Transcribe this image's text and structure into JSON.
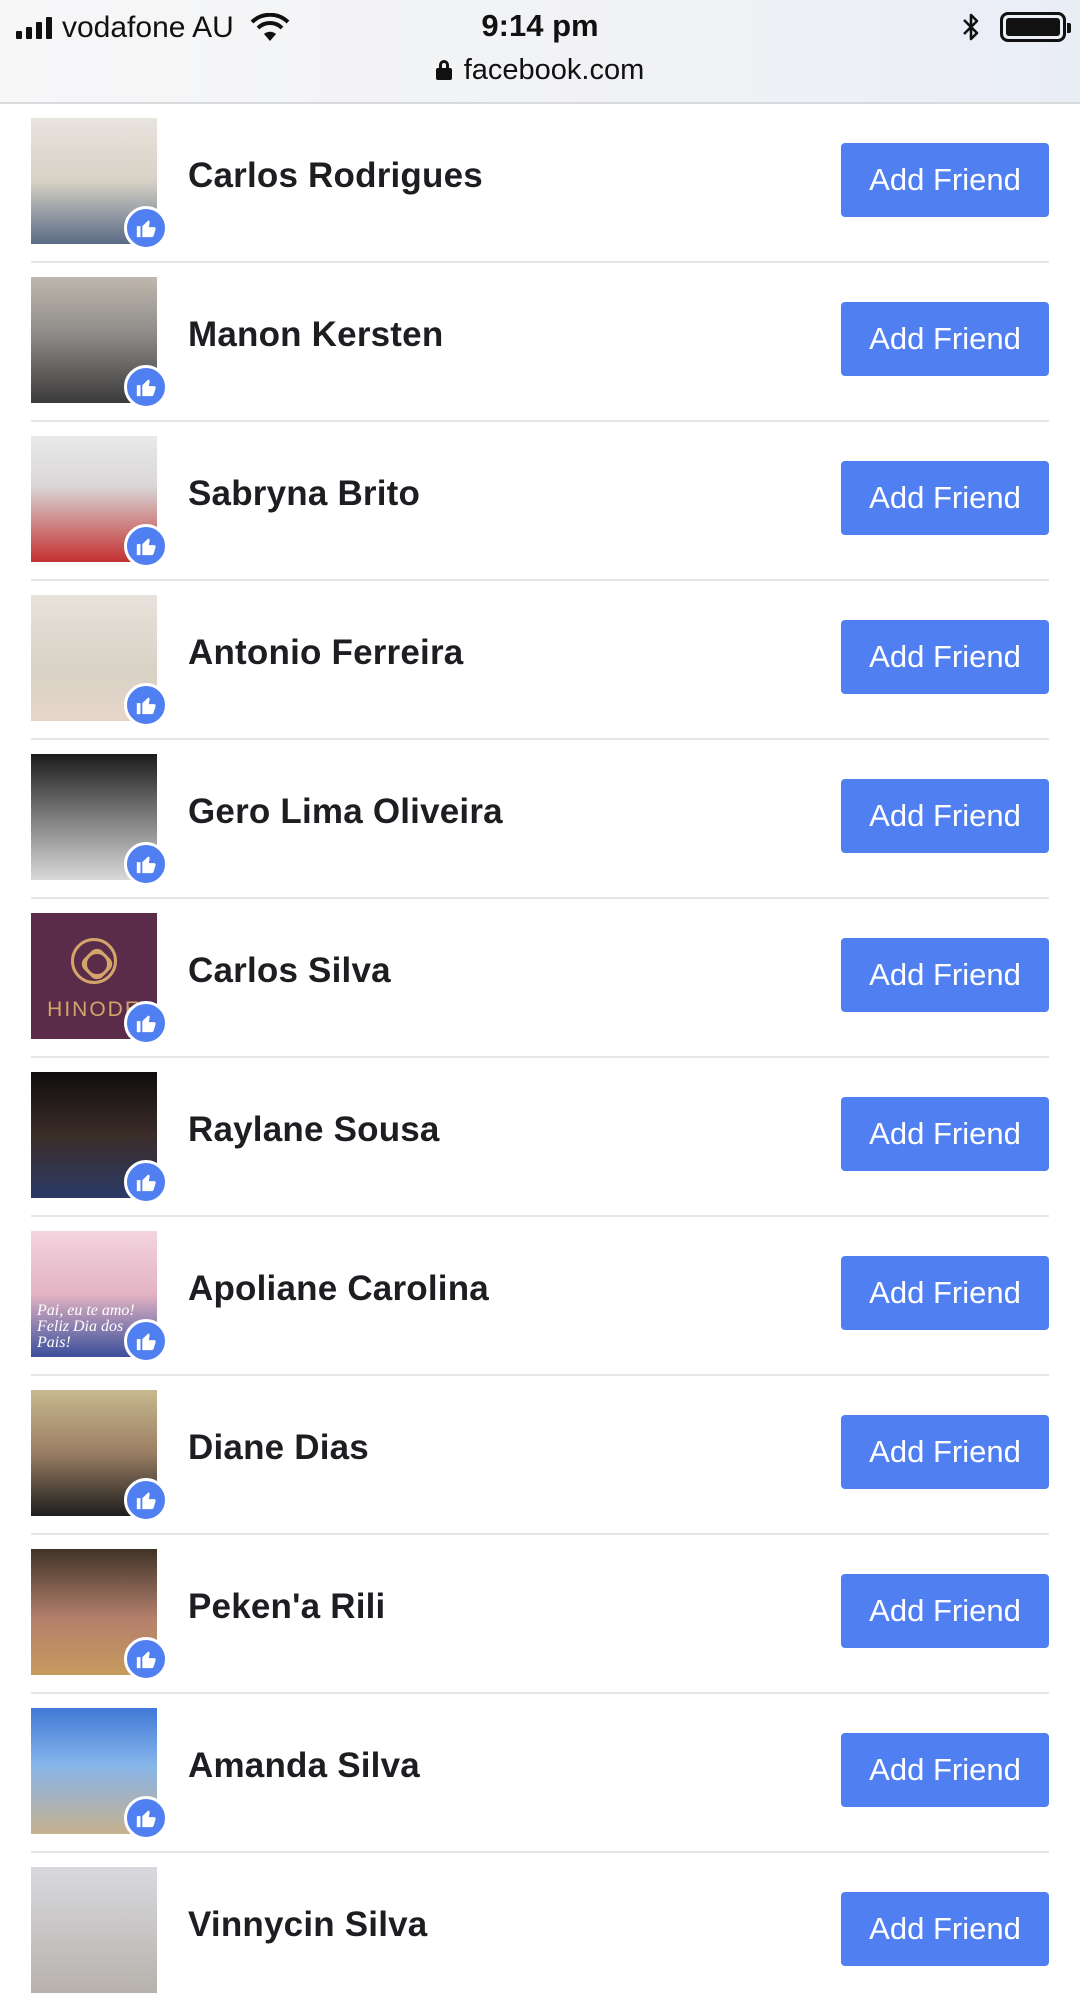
{
  "status_bar": {
    "carrier": "vodafone AU",
    "time": "9:14 pm",
    "url": "facebook.com"
  },
  "colors": {
    "accent": "#4f7ff1",
    "button_text": "#ffffff",
    "divider": "#e5e6e9"
  },
  "people": [
    {
      "name": "Carlos Rodrigues",
      "button": "Add Friend"
    },
    {
      "name": "Manon Kersten",
      "button": "Add Friend"
    },
    {
      "name": "Sabryna Brito",
      "button": "Add Friend"
    },
    {
      "name": "Antonio Ferreira",
      "button": "Add Friend"
    },
    {
      "name": "Gero Lima Oliveira",
      "button": "Add Friend"
    },
    {
      "name": "Carlos Silva",
      "button": "Add Friend",
      "avatar_text": "HINODE"
    },
    {
      "name": "Raylane Sousa",
      "button": "Add Friend"
    },
    {
      "name": "Apoliane Carolina",
      "button": "Add Friend",
      "avatar_text": "Pai, eu te amo! Feliz Dia dos Pais!"
    },
    {
      "name": "Diane Dias",
      "button": "Add Friend"
    },
    {
      "name": "Peken'a Rili",
      "button": "Add Friend"
    },
    {
      "name": "Amanda Silva",
      "button": "Add Friend"
    },
    {
      "name": "Vinnycin Silva",
      "button": "Add Friend"
    }
  ]
}
